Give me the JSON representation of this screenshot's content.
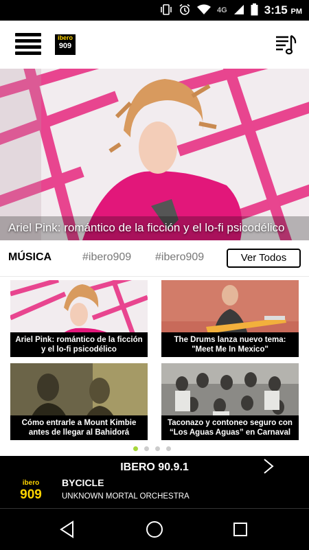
{
  "status_bar": {
    "time": "3:15",
    "ampm": "PM",
    "network": "4G"
  },
  "header": {
    "logo_top": "ibero",
    "logo_bottom": "909"
  },
  "hero": {
    "caption": "Ariel Pink: romántico de la ficción y el lo-fi psicodélico"
  },
  "section": {
    "title": "MÚSICA",
    "tags": [
      "#ibero909",
      "#ibero909"
    ],
    "ver_todos": "Ver Todos"
  },
  "cards": [
    {
      "title": "Ariel Pink: romántico de la ficción y el lo-fi psicodélico"
    },
    {
      "title": "The Drums lanza nuevo tema: \"Meet Me In Mexico\""
    },
    {
      "title": "Cómo entrarle a Mount Kimbie antes de llegar al Bahidorá"
    },
    {
      "title": "Taconazo y contoneo seguro con “Los Aguas Aguas” en Carnaval"
    }
  ],
  "carousel": {
    "pages": 4,
    "active": 0
  },
  "player": {
    "station": "IBERO 90.9.1",
    "logo_top": "ibero",
    "logo_bottom": "909",
    "song": "BYCICLE",
    "artist": "UNKNOWN MORTAL ORCHESTRA"
  },
  "colors": {
    "accent_dot": "#a6d63a",
    "logo_yellow": "#ffd400",
    "hero_pink": "#e2177a"
  }
}
